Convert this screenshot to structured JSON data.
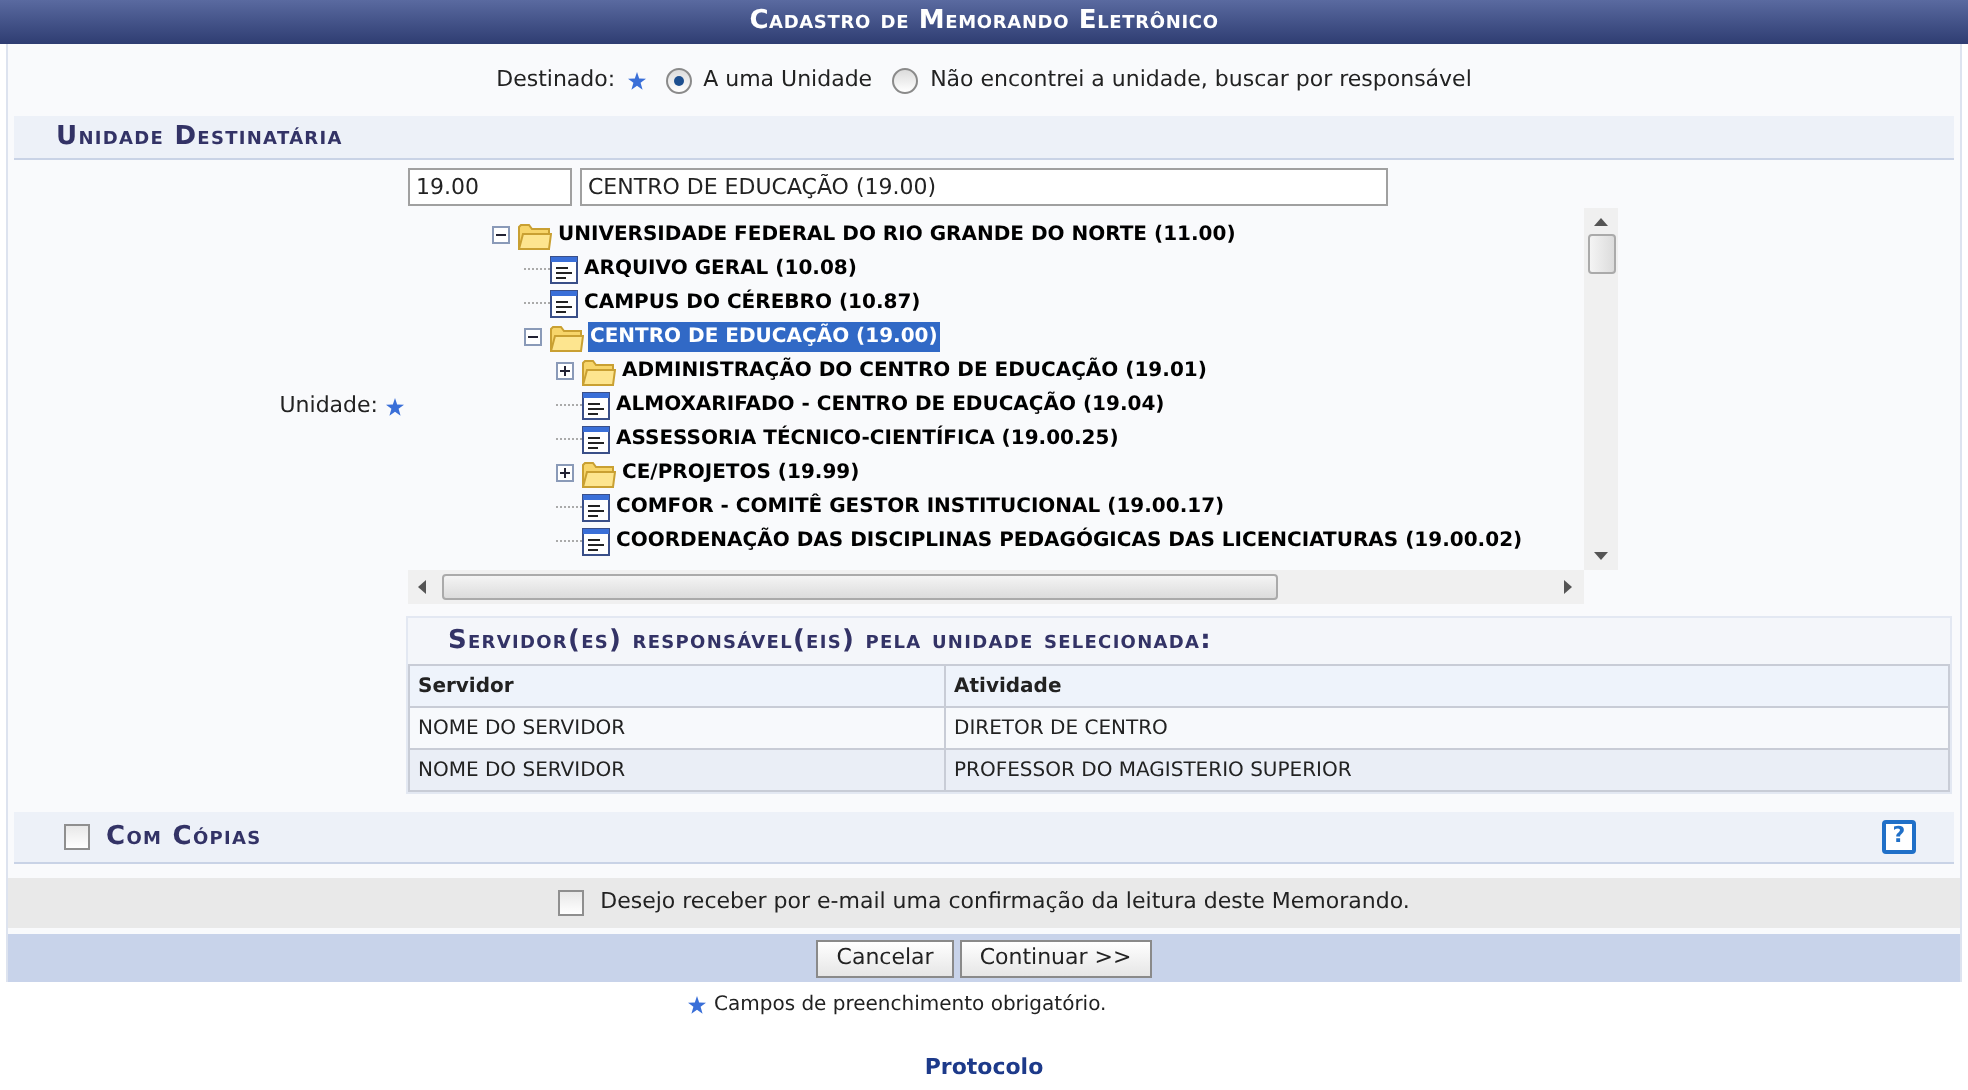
{
  "window": {
    "title": "Cadastro de Memorando Eletrônico"
  },
  "destinado": {
    "label": "Destinado:",
    "options": [
      {
        "label": "A uma Unidade",
        "selected": true
      },
      {
        "label": "Não encontrei a unidade, buscar por responsável",
        "selected": false
      }
    ]
  },
  "unidade_section": {
    "title": "Unidade Destinatária",
    "code_value": "19.00",
    "name_value": "CENTRO DE EDUCAÇÃO (19.00)",
    "field_label": "Unidade:",
    "tree": [
      {
        "label": "UNIVERSIDADE FEDERAL DO RIO GRANDE DO NORTE (11.00)",
        "kind": "folder",
        "expanded": true,
        "selected": false,
        "children": [
          {
            "label": "ARQUIVO GERAL (10.08)",
            "kind": "unit",
            "selected": false
          },
          {
            "label": "CAMPUS DO CÉREBRO (10.87)",
            "kind": "unit",
            "selected": false
          },
          {
            "label": "CENTRO DE EDUCAÇÃO (19.00)",
            "kind": "folder",
            "expanded": true,
            "selected": true,
            "children": [
              {
                "label": "ADMINISTRAÇÃO DO CENTRO DE EDUCAÇÃO (19.01)",
                "kind": "folder",
                "expanded": false,
                "selected": false
              },
              {
                "label": "ALMOXARIFADO - CENTRO DE EDUCAÇÃO (19.04)",
                "kind": "unit",
                "selected": false
              },
              {
                "label": "ASSESSORIA TÉCNICO-CIENTÍFICA (19.00.25)",
                "kind": "unit",
                "selected": false
              },
              {
                "label": "CE/PROJETOS (19.99)",
                "kind": "folder",
                "expanded": false,
                "selected": false
              },
              {
                "label": "COMFOR - COMITÊ GESTOR INSTITUCIONAL (19.00.17)",
                "kind": "unit",
                "selected": false
              },
              {
                "label": "COORDENAÇÃO DAS DISCIPLINAS PEDAGÓGICAS DAS LICENCIATURAS (19.00.02)",
                "kind": "unit",
                "selected": false
              }
            ]
          }
        ]
      }
    ]
  },
  "servidores": {
    "title": "Servidor(es) responsável(eis) pela unidade selecionada:",
    "columns": [
      "Servidor",
      "Atividade"
    ],
    "rows": [
      [
        "NOME DO SERVIDOR",
        "DIRETOR DE CENTRO"
      ],
      [
        "NOME DO SERVIDOR",
        "PROFESSOR DO MAGISTERIO SUPERIOR"
      ]
    ]
  },
  "com_copias": {
    "label": "Com Cópias",
    "checked": false,
    "help": "?"
  },
  "email_confirm": {
    "label": "Desejo receber por e-mail uma confirmação da leitura deste Memorando.",
    "checked": false
  },
  "buttons": [
    "Cancelar",
    "Continuar >>"
  ],
  "footnote": "Campos de preenchimento obrigatório.",
  "footer_link": "Protocolo"
}
